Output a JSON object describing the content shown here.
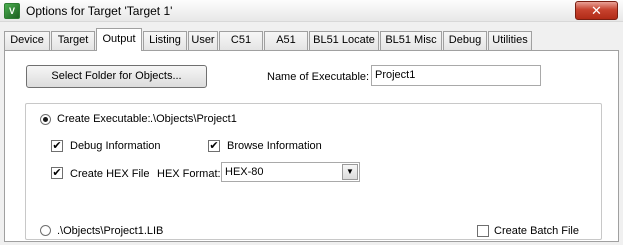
{
  "window": {
    "icon_text": "V",
    "title": "Options for Target 'Target 1'",
    "close_glyph": "✕"
  },
  "tabs": [
    {
      "label": "Device"
    },
    {
      "label": "Target"
    },
    {
      "label": "Output",
      "active": true
    },
    {
      "label": "Listing"
    },
    {
      "label": "User"
    },
    {
      "label": "C51"
    },
    {
      "label": "A51"
    },
    {
      "label": "BL51 Locate"
    },
    {
      "label": "BL51 Misc"
    },
    {
      "label": "Debug"
    },
    {
      "label": "Utilities"
    }
  ],
  "output": {
    "select_folder_label": "Select Folder for Objects...",
    "name_exec_label": "Name of Executable:",
    "name_exec_value": "Project1",
    "create_exec_label": "Create Executable:",
    "create_exec_path": ".\\Objects\\Project1",
    "create_exec_selected": true,
    "debug_info_label": "Debug Information",
    "debug_info_checked": true,
    "browse_info_label": "Browse Information",
    "browse_info_checked": true,
    "create_hex_label": "Create HEX File",
    "create_hex_checked": true,
    "hex_format_label": "HEX Format:",
    "hex_format_value": "HEX-80",
    "lib_label": ".\\Objects\\Project1.LIB",
    "lib_selected": false,
    "batch_label": "Create Batch File",
    "batch_checked": false
  },
  "icons": {
    "checkmark": "✔",
    "dropdown": "▼"
  }
}
